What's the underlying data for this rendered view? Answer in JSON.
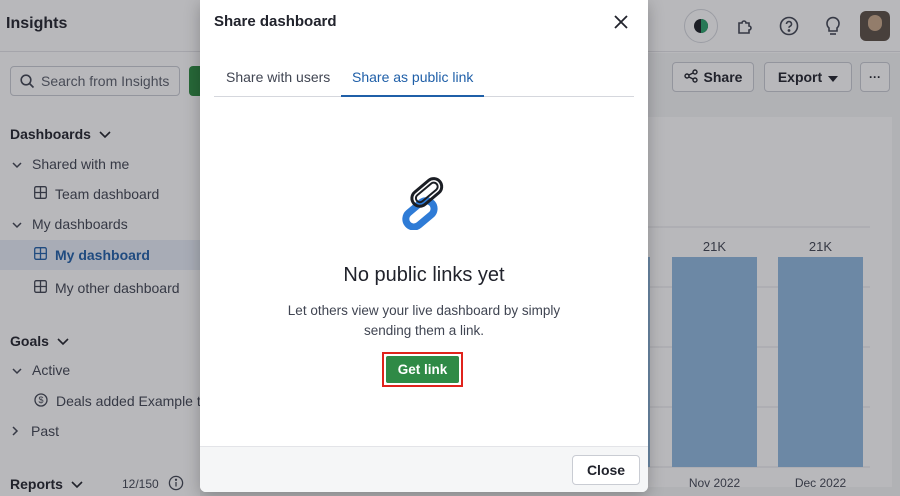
{
  "app": {
    "title": "Insights",
    "search_placeholder": "Search from Insights"
  },
  "sidebar": {
    "dashboards_label": "Dashboards",
    "shared_label": "Shared with me",
    "team_dashboard": "Team dashboard",
    "my_dashboards_label": "My dashboards",
    "my_dashboard": "My dashboard",
    "my_other_dashboard": "My other dashboard",
    "goals_label": "Goals",
    "active_label": "Active",
    "goal_item": "Deals added Example t...",
    "past_label": "Past",
    "reports_label": "Reports",
    "reports_count": "12/150"
  },
  "toolbar": {
    "share_label": "Share",
    "export_label": "Export",
    "more_label": "···"
  },
  "chart_data": {
    "type": "bar",
    "categories": [
      "Nov 2022",
      "Dec 2022"
    ],
    "values": [
      21,
      21
    ],
    "data_labels": [
      "21K",
      "21K"
    ],
    "bar_color": "#8fb9df"
  },
  "modal": {
    "title": "Share dashboard",
    "tabs": [
      {
        "label": "Share with users",
        "active": false
      },
      {
        "label": "Share as public link",
        "active": true
      }
    ],
    "empty_title": "No public links yet",
    "empty_desc": "Let others view your live dashboard by simply sending them a link.",
    "get_link_label": "Get link",
    "close_label": "Close"
  },
  "colors": {
    "accent": "#1f5fa8",
    "primary_button": "#2f8a46",
    "highlight": "#e0231c",
    "link_icon_blue": "#2e7bd6"
  }
}
